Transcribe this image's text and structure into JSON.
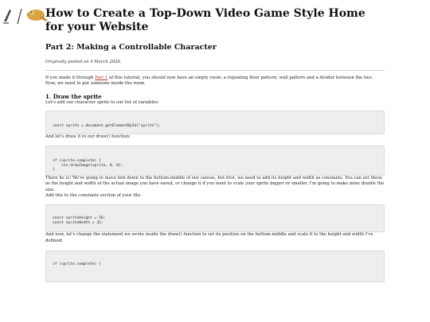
{
  "site": {
    "logo_icon": "pen-and-parrot-logo-icon",
    "logo_separator": "/"
  },
  "article": {
    "title": "How to Create a Top-Down Video Game Style Home for your Website",
    "subtitle": "Part 2: Making a Controllable Character",
    "posted": "Originally posted on 4 March 2026.",
    "intro": {
      "before_link": "If you made it through ",
      "link_text": "Part 1",
      "after_link": " of this tutorial, you should now have an empty room: a repeating floor pattern, wall pattern and a divider between the two. Now, we need to put someone inside the room."
    },
    "section1_heading": "1. Draw the sprite",
    "p1": "Let's add our character sprite to our list of variables:",
    "code1": [
      "const sprite = document.getElementById(\"sprite\");"
    ],
    "p2": "And let's draw it in our draw() function:",
    "code2": [
      "if (sprite.complete) {",
      "    ctx.drawImage(sprite, 0, 0);",
      "}"
    ],
    "p3": "There he is! We're going to move him down to the bottom-middle of our canvas, but first, we need to add its height and width as constants. You can set these as the height and width of the actual image you have saved, or change it if you want to scale your sprite bigger or smaller. I'm going to make mine double the size.",
    "p4": "Add this to the constants section of your file:",
    "code3": [
      "const spriteHeight = 56;",
      "const spriteWidth = 32;"
    ],
    "p5": "And now, let's change the statement we wrote inside the draw() function to set its position on the bottom-middle and scale it to the height and width I've defined:",
    "code4": [
      "if (sprite.complete) {"
    ]
  },
  "colors": {
    "link": "#b23a2e",
    "code_background": "#eeeeee",
    "logo_gold": "#d9a441"
  }
}
